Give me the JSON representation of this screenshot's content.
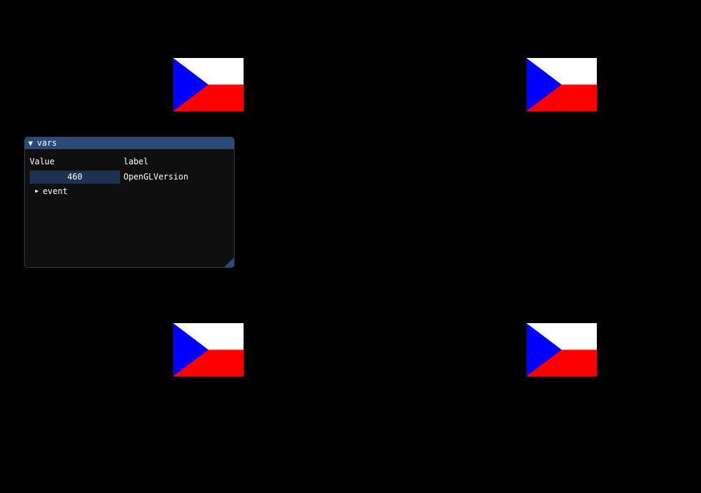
{
  "window": {
    "title": "vars",
    "collapse_icon": "triangle-down-icon",
    "columns": {
      "value_header": "Value",
      "label_header": "label"
    },
    "field": {
      "value": "460",
      "label": "OpenGLVersion"
    },
    "tree": {
      "expand_icon": "triangle-right-icon",
      "label": "event"
    }
  },
  "colors": {
    "background": "#000000",
    "window_bg": "#0f0f0f",
    "title_bar": "#294a7a",
    "value_box": "#1d3150",
    "flag_white": "#ffffff",
    "flag_red": "#ff0000",
    "flag_blue": "#0000ff"
  },
  "flags": [
    {
      "name": "czech-flag"
    },
    {
      "name": "czech-flag"
    },
    {
      "name": "czech-flag"
    },
    {
      "name": "czech-flag"
    }
  ]
}
